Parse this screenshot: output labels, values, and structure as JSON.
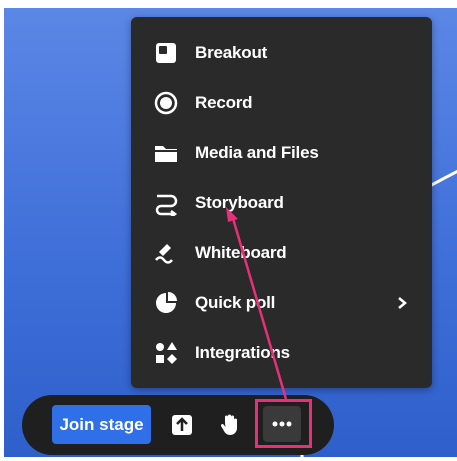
{
  "menu": {
    "items": [
      {
        "label": "Breakout",
        "icon": "breakout-icon"
      },
      {
        "label": "Record",
        "icon": "record-icon"
      },
      {
        "label": "Media and Files",
        "icon": "folder-icon"
      },
      {
        "label": "Storyboard",
        "icon": "storyboard-icon"
      },
      {
        "label": "Whiteboard",
        "icon": "whiteboard-icon"
      },
      {
        "label": "Quick poll",
        "icon": "pie-chart-icon",
        "has_submenu": true
      },
      {
        "label": "Integrations",
        "icon": "integrations-icon"
      }
    ]
  },
  "toolbar": {
    "join_stage_label": "Join stage",
    "buttons": [
      "upload-icon",
      "raise-hand-icon",
      "more-icon"
    ]
  },
  "colors": {
    "accent": "#2f6fe8",
    "highlight": "#e6317a",
    "menu_bg": "#2a2a2a"
  }
}
